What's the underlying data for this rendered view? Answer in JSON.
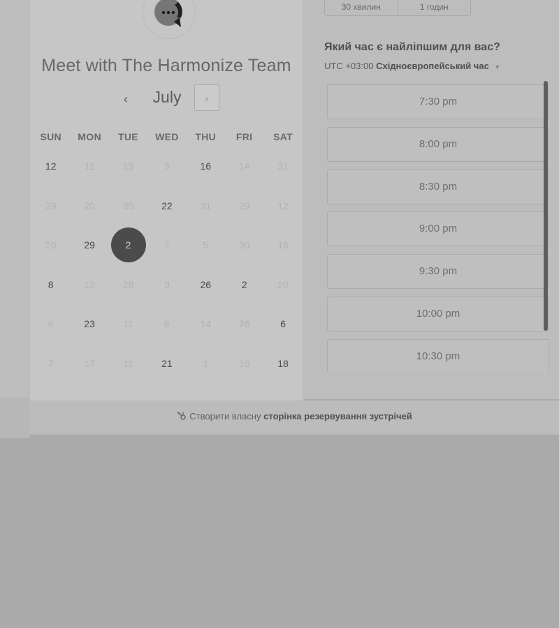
{
  "header": {
    "title": "Meet with The Harmonize Team"
  },
  "calendar": {
    "month": "July",
    "prev_symbol": "‹",
    "next_symbol": "›",
    "weekdays": [
      "SUN",
      "MON",
      "TUE",
      "WED",
      "THU",
      "FRI",
      "SAT"
    ],
    "days": [
      {
        "label": "12",
        "state": "active"
      },
      {
        "label": "11",
        "state": "inactive"
      },
      {
        "label": "13",
        "state": "inactive"
      },
      {
        "label": "3",
        "state": "inactive"
      },
      {
        "label": "16",
        "state": "active"
      },
      {
        "label": "14",
        "state": "inactive"
      },
      {
        "label": "31",
        "state": "inactive"
      },
      {
        "label": "29",
        "state": "inactive"
      },
      {
        "label": "20",
        "state": "inactive"
      },
      {
        "label": "30",
        "state": "inactive"
      },
      {
        "label": "22",
        "state": "active"
      },
      {
        "label": "31",
        "state": "inactive"
      },
      {
        "label": "29",
        "state": "inactive"
      },
      {
        "label": "12",
        "state": "inactive"
      },
      {
        "label": "20",
        "state": "inactive"
      },
      {
        "label": "29",
        "state": "active"
      },
      {
        "label": "2",
        "state": "selected"
      },
      {
        "label": "7",
        "state": "inactive"
      },
      {
        "label": "5",
        "state": "inactive"
      },
      {
        "label": "30",
        "state": "inactive"
      },
      {
        "label": "16",
        "state": "inactive"
      },
      {
        "label": "8",
        "state": "active"
      },
      {
        "label": "12",
        "state": "inactive"
      },
      {
        "label": "28",
        "state": "inactive"
      },
      {
        "label": "9",
        "state": "inactive"
      },
      {
        "label": "26",
        "state": "active"
      },
      {
        "label": "2",
        "state": "active"
      },
      {
        "label": "20",
        "state": "inactive"
      },
      {
        "label": "6",
        "state": "inactive"
      },
      {
        "label": "23",
        "state": "active"
      },
      {
        "label": "11",
        "state": "inactive"
      },
      {
        "label": "6",
        "state": "inactive"
      },
      {
        "label": "14",
        "state": "inactive"
      },
      {
        "label": "26",
        "state": "inactive"
      },
      {
        "label": "6",
        "state": "active"
      },
      {
        "label": "7",
        "state": "inactive"
      },
      {
        "label": "17",
        "state": "inactive"
      },
      {
        "label": "11",
        "state": "inactive"
      },
      {
        "label": "21",
        "state": "active"
      },
      {
        "label": "1",
        "state": "inactive"
      },
      {
        "label": "16",
        "state": "inactive"
      },
      {
        "label": "18",
        "state": "active"
      }
    ]
  },
  "duration": {
    "options": [
      "30 хвилин",
      "1 годин"
    ]
  },
  "times": {
    "question": "Який час є найліпшим для вас?",
    "timezone_prefix": "UTC +03:00",
    "timezone_name": "Східноєвропейський час",
    "timezone_caret": "▾",
    "slots": [
      "7:30 pm",
      "8:00 pm",
      "8:30 pm",
      "9:00 pm",
      "9:30 pm",
      "10:00 pm",
      "10:30 pm"
    ]
  },
  "footer": {
    "text_prefix": "Створити власну",
    "text_link": "сторінка резервування зустрічей"
  }
}
